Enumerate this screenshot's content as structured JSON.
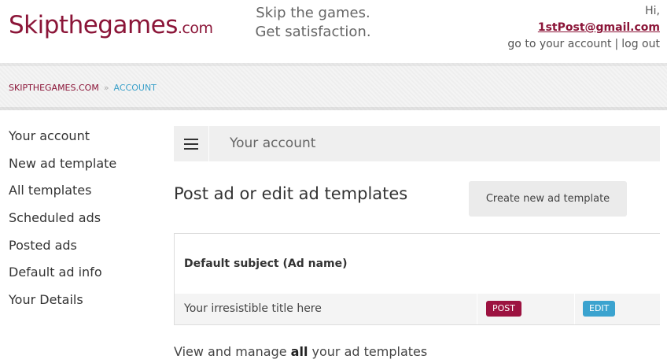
{
  "header": {
    "logo_main": "Skipthegames",
    "logo_suffix": ".com",
    "tagline_line1": "Skip the games.",
    "tagline_line2": "Get satisfaction.",
    "greeting": "Hi,",
    "user_email": "1stPost@gmail.com",
    "account_link": "go to your account",
    "separator": "|",
    "logout_link": "log out",
    "brand_color": "#8b1538"
  },
  "breadcrumb": {
    "home": "SKIPTHEGAMES.COM",
    "separator": "»",
    "current": "ACCOUNT"
  },
  "sidebar": {
    "items": [
      {
        "label": "Your account"
      },
      {
        "label": "New ad template"
      },
      {
        "label": "All templates"
      },
      {
        "label": "Scheduled ads"
      },
      {
        "label": "Posted ads"
      },
      {
        "label": "Default ad info"
      },
      {
        "label": "Your Details"
      }
    ]
  },
  "main": {
    "topbar_title": "Your account",
    "section_title": "Post ad or edit ad templates",
    "create_button": "Create new ad template",
    "template_header": "Default subject (Ad name)",
    "template_row": {
      "title": "Your irresistible title here",
      "post_label": "POST",
      "edit_label": "EDIT"
    },
    "footer_pre": "View and manage ",
    "footer_bold": "all",
    "footer_post": " your ad templates"
  },
  "icons": {
    "menu": "hamburger-menu-icon"
  }
}
